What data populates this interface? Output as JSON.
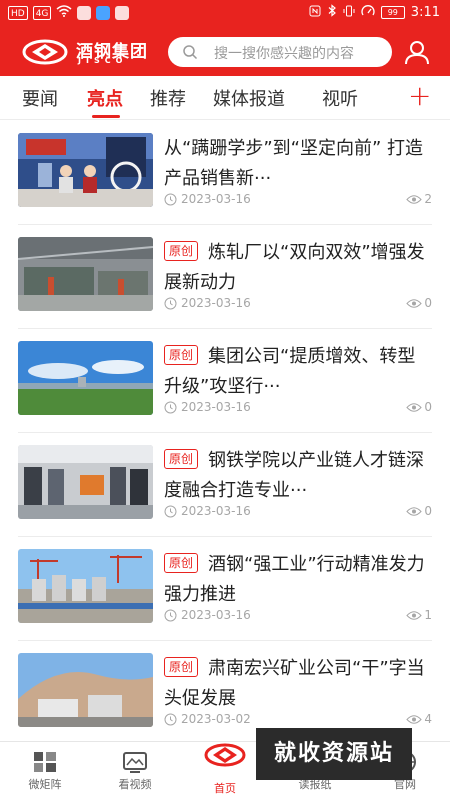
{
  "status_bar": {
    "left_chips": [
      "HD",
      "4G"
    ],
    "battery": "99",
    "time": "3:11"
  },
  "header": {
    "logo_cn": "酒钢集团",
    "logo_en": "JISCO",
    "search_placeholder": "搜一搜你感兴趣的内容"
  },
  "tabs": [
    {
      "label": "要闻",
      "active": false
    },
    {
      "label": "亮点",
      "active": true
    },
    {
      "label": "推荐",
      "active": false
    },
    {
      "label": "媒体报道",
      "active": false
    },
    {
      "label": "视听",
      "active": false
    }
  ],
  "tab_add_label": "+",
  "news": [
    {
      "badge": "",
      "title": "从“蹒跚学步”到“坚定向前” 打造产品销售新···",
      "date": "2023-03-16",
      "views": "2",
      "thumb_icon": "livestream-thumbnail"
    },
    {
      "badge": "原创",
      "title": "炼轧厂以“双向双效”增强发展新动力",
      "date": "2023-03-16",
      "views": "0",
      "thumb_icon": "factory-workshop-thumbnail"
    },
    {
      "badge": "原创",
      "title": "集团公司“提质增效、转型升级”攻坚行···",
      "date": "2023-03-16",
      "views": "0",
      "thumb_icon": "landscape-sky-thumbnail"
    },
    {
      "badge": "原创",
      "title": "钢铁学院以产业链人才链深度融合打造专业···",
      "date": "2023-03-16",
      "views": "0",
      "thumb_icon": "classroom-robot-thumbnail"
    },
    {
      "badge": "原创",
      "title": "酒钢“强工业”行动精准发力强力推进",
      "date": "2023-03-16",
      "views": "1",
      "thumb_icon": "industrial-site-thumbnail"
    },
    {
      "badge": "原创",
      "title": "肃南宏兴矿业公司“干”字当头促发展",
      "date": "2023-03-02",
      "views": "4",
      "thumb_icon": "mine-site-thumbnail"
    }
  ],
  "bottom_nav": [
    {
      "label": "微矩阵",
      "icon": "grid-icon",
      "active": false
    },
    {
      "label": "看视频",
      "icon": "video-icon",
      "active": false
    },
    {
      "label": "首页",
      "icon": "home-logo-icon",
      "active": true
    },
    {
      "label": "读报纸",
      "icon": "newspaper-icon",
      "active": false
    },
    {
      "label": "官网",
      "icon": "globe-icon",
      "active": false
    }
  ],
  "watermark": "就收资源站",
  "colors": {
    "brand_red": "#e8231f"
  }
}
